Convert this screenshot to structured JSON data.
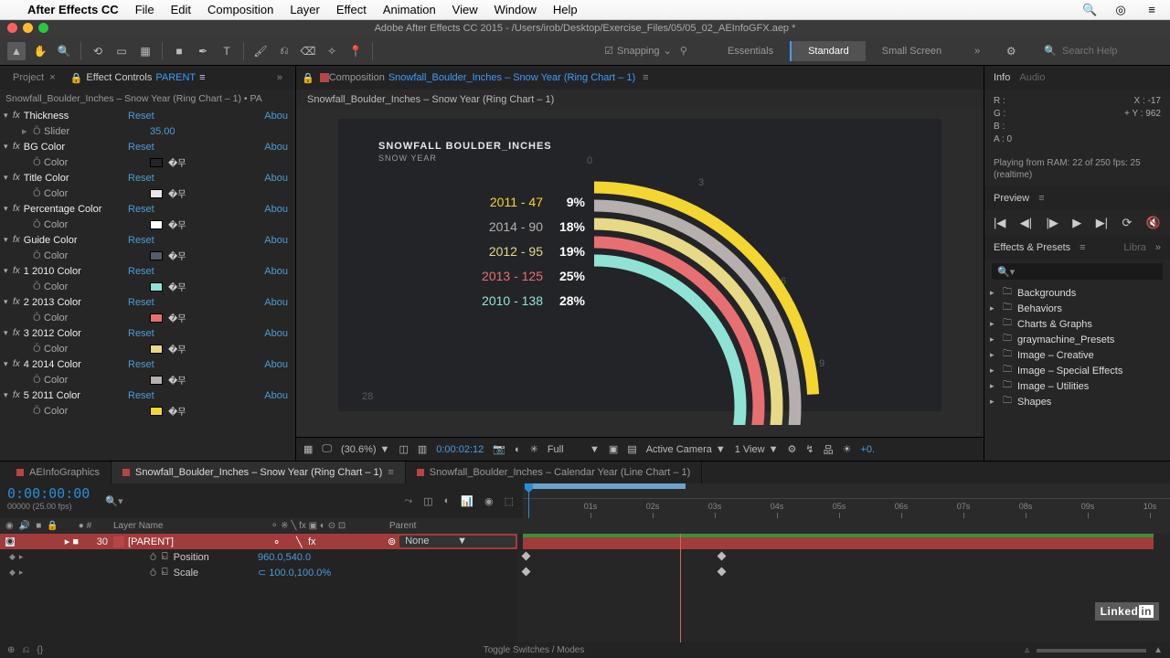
{
  "mac_menu": [
    "After Effects CC",
    "File",
    "Edit",
    "Composition",
    "Layer",
    "Effect",
    "Animation",
    "View",
    "Window",
    "Help"
  ],
  "window_title": "Adobe After Effects CC 2015 - /Users/irob/Desktop/Exercise_Files/05/05_02_AEInfoGFX.aep *",
  "snapping_label": "Snapping",
  "workspaces": [
    "Essentials",
    "Standard",
    "Small Screen"
  ],
  "workspace_active": 1,
  "search_help_ph": "Search Help",
  "left_panel": {
    "project_tab": "Project",
    "ec_tab_prefix": "Effect Controls",
    "ec_tab_target": "PARENT",
    "breadcrumb": "Snowfall_Boulder_Inches – Snow Year (Ring Chart – 1) • PA",
    "reset": "Reset",
    "about": "Abou",
    "effects": [
      {
        "name": "Thickness",
        "sub": "Slider",
        "val": "35.00",
        "type": "slider"
      },
      {
        "name": "BG Color",
        "sub": "Color",
        "type": "color",
        "color": "#232428"
      },
      {
        "name": "Title Color",
        "sub": "Color",
        "type": "color",
        "color": "#e8e8ea"
      },
      {
        "name": "Percentage Color",
        "sub": "Color",
        "type": "color",
        "color": "#ffffff"
      },
      {
        "name": "Guide Color",
        "sub": "Color",
        "type": "color",
        "color": "#555c6a"
      },
      {
        "name": "1 2010 Color",
        "sub": "Color",
        "type": "color",
        "color": "#8fe3d5"
      },
      {
        "name": "2 2013 Color",
        "sub": "Color",
        "type": "color",
        "color": "#e76f72"
      },
      {
        "name": "3 2012 Color",
        "sub": "Color",
        "type": "color",
        "color": "#e8d986"
      },
      {
        "name": "4 2014 Color",
        "sub": "Color",
        "type": "color",
        "color": "#b5b0ae"
      },
      {
        "name": "5 2011 Color",
        "sub": "Color",
        "type": "color",
        "color": "#f4d632"
      }
    ]
  },
  "comp": {
    "prefix": "Composition",
    "name": "Snowfall_Boulder_Inches – Snow Year (Ring Chart – 1)",
    "bread": "Snowfall_Boulder_Inches – Snow Year (Ring Chart – 1)"
  },
  "chart_data": {
    "type": "ring",
    "title": "SNOWFALL BOULDER_INCHES",
    "subtitle": "SNOW YEAR",
    "guides": [
      "0",
      "3",
      "6",
      "9",
      "28"
    ],
    "series": [
      {
        "label": "2011 - 47",
        "pct": "9%",
        "value": 9,
        "color": "#f4d632"
      },
      {
        "label": "2014 - 90",
        "pct": "18%",
        "value": 18,
        "color": "#b5b0ae"
      },
      {
        "label": "2012 - 95",
        "pct": "19%",
        "value": 19,
        "color": "#e8d986"
      },
      {
        "label": "2013 - 125",
        "pct": "25%",
        "value": 25,
        "color": "#e76f72"
      },
      {
        "label": "2010 - 138",
        "pct": "28%",
        "value": 28,
        "color": "#8fe3d5"
      }
    ]
  },
  "viewer_bar": {
    "zoom": "(30.6%)",
    "time": "0:00:02:12",
    "res": "Full",
    "camera": "Active Camera",
    "view": "1 View"
  },
  "right": {
    "info": "Info",
    "audio": "Audio",
    "rgb": {
      "R": "R :",
      "G": "G :",
      "B": "B :",
      "A": "A :  0"
    },
    "xy": {
      "x": "X : -17",
      "y": "Y :  962"
    },
    "play_msg": "Playing from RAM: 22 of 250 fps: 25 (realtime)",
    "preview": "Preview",
    "ep": "Effects & Presets",
    "ep_search": "Libra",
    "folders": [
      "Backgrounds",
      "Behaviors",
      "Charts & Graphs",
      "graymachine_Presets",
      "Image – Creative",
      "Image – Special Effects",
      "Image – Utilities",
      "Shapes"
    ]
  },
  "timeline": {
    "tabs": [
      {
        "label": "AEInfoGraphics",
        "active": false
      },
      {
        "label": "Snowfall_Boulder_Inches – Snow Year (Ring Chart – 1)",
        "active": true
      },
      {
        "label": "Snowfall_Boulder_Inches – Calendar Year (Line Chart – 1)",
        "active": false
      }
    ],
    "current_time": "0:00:00:00",
    "frame_info": "00000 (25.00 fps)",
    "col_layer": "Layer Name",
    "col_parent": "Parent",
    "ruler": [
      "01s",
      "02s",
      "03s",
      "04s",
      "05s",
      "06s",
      "07s",
      "08s",
      "09s",
      "10s"
    ],
    "layer": {
      "num": "30",
      "name": "PARENT",
      "parent": "None"
    },
    "props": [
      {
        "name": "Position",
        "val": "960.0,540.0"
      },
      {
        "name": "Scale",
        "val": "100.0,100.0%"
      }
    ],
    "toggle": "Toggle Switches / Modes"
  }
}
